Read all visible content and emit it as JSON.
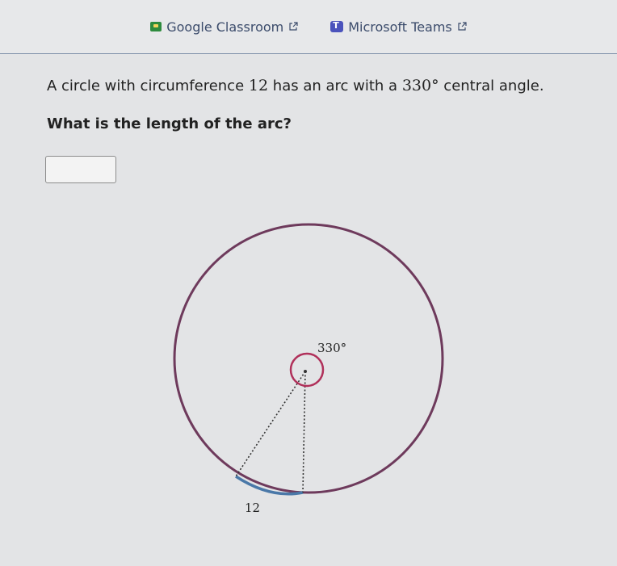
{
  "topbar": {
    "google_classroom": "Google Classroom",
    "microsoft_teams": "Microsoft Teams"
  },
  "question": {
    "text_before": "A circle with circumference ",
    "circumference": "12",
    "text_middle": " has an arc with a ",
    "angle": "330°",
    "text_after": " central angle.",
    "prompt": "What is the length of the arc?"
  },
  "answer": {
    "value": ""
  },
  "figure": {
    "angle_label": "330°",
    "arc_label": "12"
  },
  "colors": {
    "circle": "#6e3a5c",
    "minor_arc": "#4a78a8",
    "angle_mark": "#b0305a"
  }
}
